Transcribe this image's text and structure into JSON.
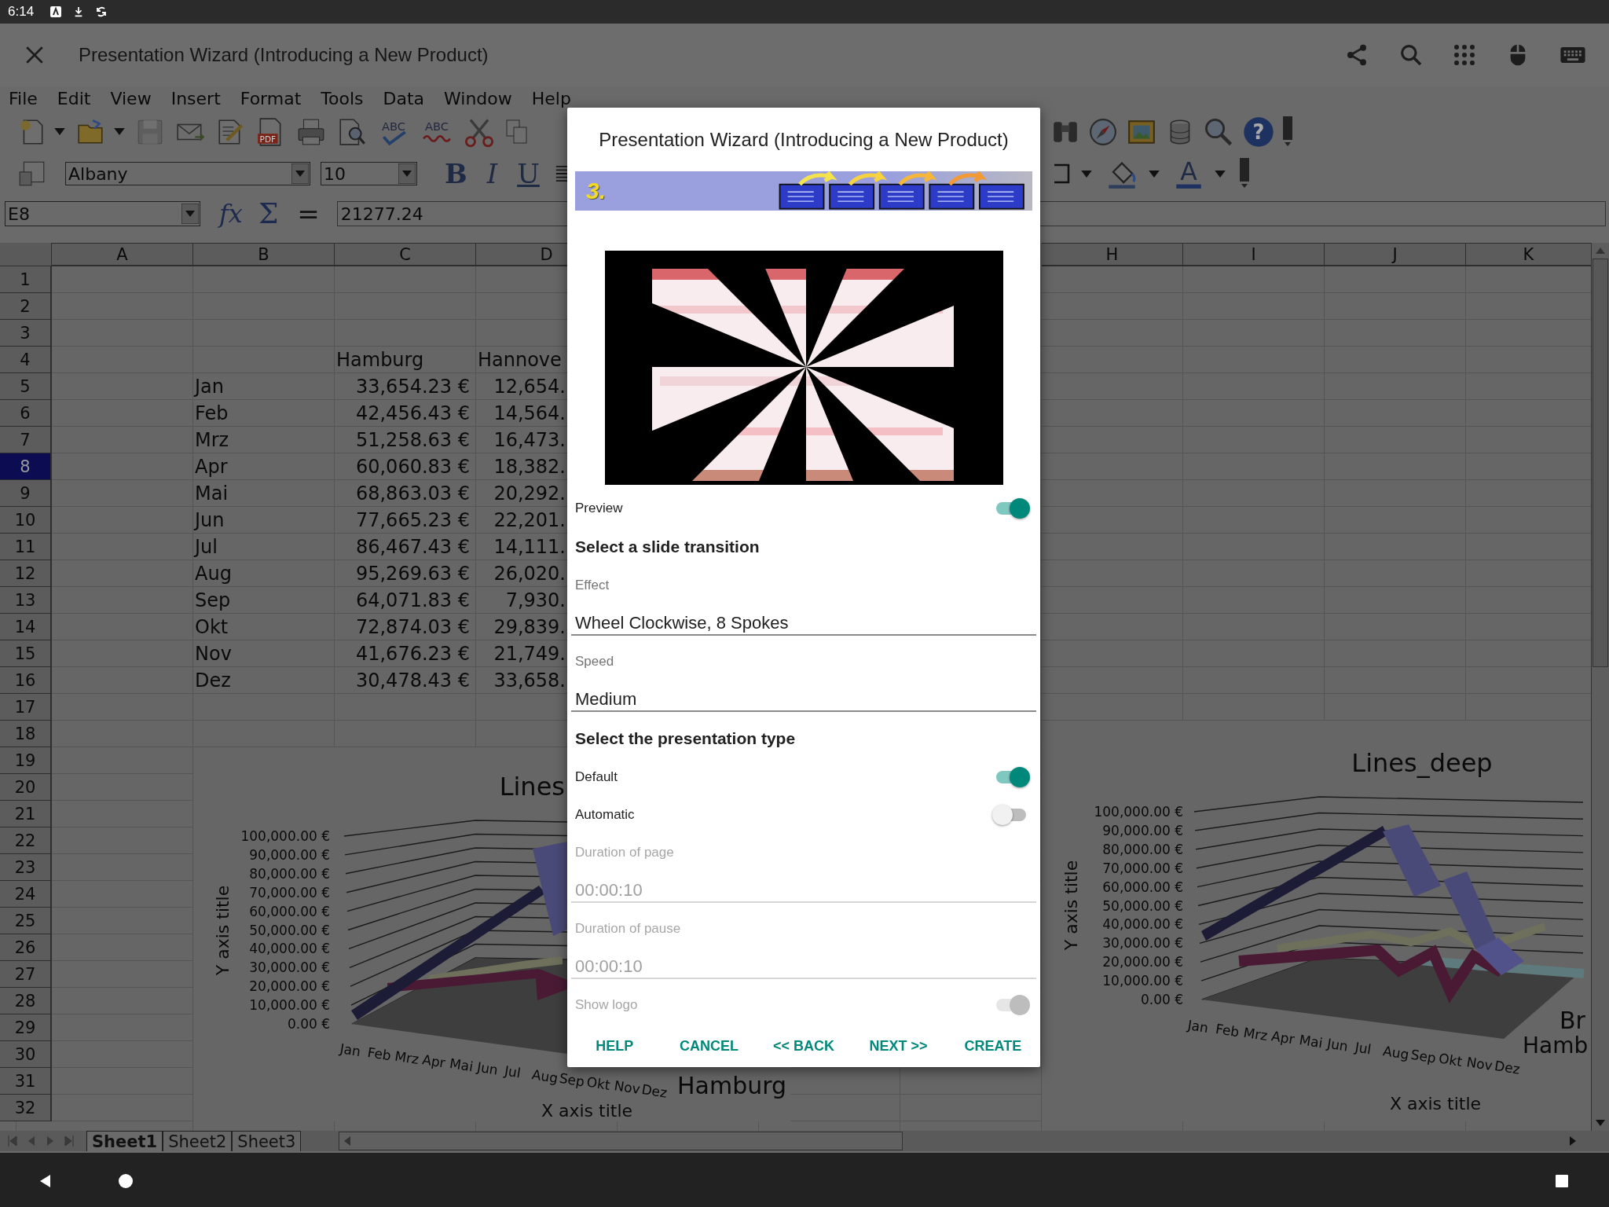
{
  "status_bar": {
    "time": "6:14"
  },
  "app_bar": {
    "title": "Presentation Wizard (Introducing a New Product)"
  },
  "menu": [
    {
      "label": "File"
    },
    {
      "label": "Edit"
    },
    {
      "label": "View"
    },
    {
      "label": "Insert"
    },
    {
      "label": "Format"
    },
    {
      "label": "Tools"
    },
    {
      "label": "Data"
    },
    {
      "label": "Window"
    },
    {
      "label": "Help"
    }
  ],
  "toolbar": {
    "pdf": "PDF",
    "spellcheck": "ABC",
    "autospell": "ABC",
    "help": "?",
    "font_name": "Albany",
    "font_size": "10",
    "bold": "B",
    "italic": "I",
    "underline": "U",
    "font_color": "A"
  },
  "formula_bar": {
    "cell_ref": "E8",
    "function": "fx",
    "sum": "Σ",
    "equals": "=",
    "value": "21277.24"
  },
  "sheet": {
    "columns": [
      {
        "label": "A"
      },
      {
        "label": "B"
      },
      {
        "label": "C"
      },
      {
        "label": "D"
      },
      {
        "label": "H"
      },
      {
        "label": "I"
      },
      {
        "label": "J"
      },
      {
        "label": "K"
      }
    ],
    "rows": [
      {
        "number": "1",
        "selected": false
      },
      {
        "number": "2",
        "selected": false
      },
      {
        "number": "3",
        "selected": false
      },
      {
        "number": "4",
        "selected": false,
        "kind": "header",
        "c": "Hamburg",
        "d": "Hannove"
      },
      {
        "number": "5",
        "selected": false,
        "kind": "data",
        "b": "Jan",
        "c": "33,654.23 €",
        "d": "12,654."
      },
      {
        "number": "6",
        "selected": false,
        "kind": "data",
        "b": "Feb",
        "c": "42,456.43 €",
        "d": "14,564."
      },
      {
        "number": "7",
        "selected": false,
        "kind": "data",
        "b": "Mrz",
        "c": "51,258.63 €",
        "d": "16,473."
      },
      {
        "number": "8",
        "selected": true,
        "kind": "data",
        "b": "Apr",
        "c": "60,060.83 €",
        "d": "18,382."
      },
      {
        "number": "9",
        "selected": false,
        "kind": "data",
        "b": "Mai",
        "c": "68,863.03 €",
        "d": "20,292."
      },
      {
        "number": "10",
        "selected": false,
        "kind": "data",
        "b": "Jun",
        "c": "77,665.23 €",
        "d": "22,201."
      },
      {
        "number": "11",
        "selected": false,
        "kind": "data",
        "b": "Jul",
        "c": "86,467.43 €",
        "d": "14,111."
      },
      {
        "number": "12",
        "selected": false,
        "kind": "data",
        "b": "Aug",
        "c": "95,269.63 €",
        "d": "26,020."
      },
      {
        "number": "13",
        "selected": false,
        "kind": "data",
        "b": "Sep",
        "c": "64,071.83 €",
        "d": "7,930."
      },
      {
        "number": "14",
        "selected": false,
        "kind": "data",
        "b": "Okt",
        "c": "72,874.03 €",
        "d": "29,839."
      },
      {
        "number": "15",
        "selected": false,
        "kind": "data",
        "b": "Nov",
        "c": "41,676.23 €",
        "d": "21,749."
      },
      {
        "number": "16",
        "selected": false,
        "kind": "data",
        "b": "Dez",
        "c": "30,478.43 €",
        "d": "33,658."
      },
      {
        "number": "17",
        "selected": false
      },
      {
        "number": "18",
        "selected": false
      },
      {
        "number": "19",
        "selected": false
      },
      {
        "number": "20",
        "selected": false
      },
      {
        "number": "21",
        "selected": false
      },
      {
        "number": "22",
        "selected": false
      },
      {
        "number": "23",
        "selected": false
      },
      {
        "number": "24",
        "selected": false
      },
      {
        "number": "25",
        "selected": false
      },
      {
        "number": "26",
        "selected": false
      },
      {
        "number": "27",
        "selected": false
      },
      {
        "number": "28",
        "selected": false
      },
      {
        "number": "29",
        "selected": false
      },
      {
        "number": "30",
        "selected": false
      },
      {
        "number": "31",
        "selected": false
      },
      {
        "number": "32",
        "selected": false
      }
    ]
  },
  "charts": [
    {
      "title": "Lines",
      "y_title": "Y axis title",
      "y_ticks": [
        "100,000.00 €",
        "90,000.00 €",
        "80,000.00 €",
        "70,000.00 €",
        "60,000.00 €",
        "50,000.00 €",
        "40,000.00 €",
        "30,000.00 €",
        "20,000.00 €",
        "10,000.00 €",
        "0.00 €"
      ],
      "x_labels": [
        "Jan",
        "Feb",
        "Mrz",
        "Apr",
        "Mai",
        "Jun",
        "Jul",
        "Aug",
        "Sep",
        "Okt",
        "Nov",
        "Dez"
      ],
      "legend": [
        "Hamburg"
      ],
      "x_title": "X axis title"
    },
    {
      "title": "Lines_deep",
      "y_title": "Y axis title",
      "y_ticks": [
        "100,000.00 €",
        "90,000.00 €",
        "80,000.00 €",
        "70,000.00 €",
        "60,000.00 €",
        "50,000.00 €",
        "40,000.00 €",
        "30,000.00 €",
        "20,000.00 €",
        "10,000.00 €",
        "0.00 €"
      ],
      "x_labels": [
        "Jan",
        "Feb",
        "Mrz",
        "Apr",
        "Mai",
        "Jun",
        "Jul",
        "Aug",
        "Sep",
        "Okt",
        "Nov",
        "Dez"
      ],
      "legend": [
        "Br",
        "Hamb"
      ],
      "x_title": "X axis title"
    }
  ],
  "sheet_tabs": [
    {
      "label": "Sheet1",
      "selected": true
    },
    {
      "label": "Sheet2",
      "selected": false
    },
    {
      "label": "Sheet3",
      "selected": false
    }
  ],
  "dialog": {
    "title": "Presentation Wizard (Introducing a New Product)",
    "step": "3.",
    "items": [
      {
        "kind": "toggle",
        "label": "Preview",
        "on": true,
        "disabled": false
      },
      {
        "kind": "heading",
        "label": "Select a slide transition"
      },
      {
        "kind": "field",
        "label": "Effect",
        "value": "Wheel Clockwise, 8 Spokes",
        "disabled": false
      },
      {
        "kind": "field",
        "label": "Speed",
        "value": "Medium",
        "disabled": false
      },
      {
        "kind": "heading",
        "label": "Select the presentation type"
      },
      {
        "kind": "toggle",
        "label": "Default",
        "on": true,
        "disabled": false
      },
      {
        "kind": "toggle",
        "label": "Automatic",
        "on": false,
        "disabled": false
      },
      {
        "kind": "field",
        "label": "Duration of page",
        "value": "00:00:10",
        "disabled": true
      },
      {
        "kind": "field",
        "label": "Duration of pause",
        "value": "00:00:10",
        "disabled": true
      },
      {
        "kind": "toggle",
        "label": "Show logo",
        "on": true,
        "disabled": true
      }
    ],
    "buttons": [
      "HELP",
      "CANCEL",
      "<< BACK",
      "NEXT >>",
      "CREATE"
    ]
  }
}
